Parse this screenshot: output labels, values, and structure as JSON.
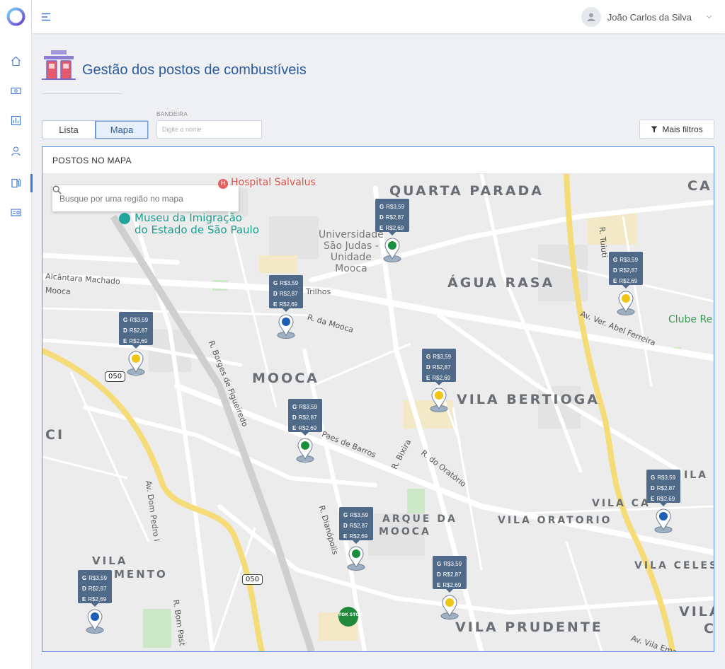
{
  "user": {
    "name": "João Carlos da Silva"
  },
  "page": {
    "title": "Gestão dos postos de combustíveis"
  },
  "view_toggle": {
    "list_label": "Lista",
    "map_label": "Mapa",
    "active": "Mapa"
  },
  "filters": {
    "brand_label": "BANDEIRA",
    "brand_placeholder": "Digite o nome",
    "more_filters_label": "Mais filtros"
  },
  "map_panel": {
    "title": "POSTOS NO MAPA",
    "search_placeholder": "Busque por uma região no mapa"
  },
  "map_labels": {
    "districts": [
      "QUARTA PARADA",
      "ÁGUA RASA",
      "MOOCA",
      "VILA BERTIOGA",
      "VILA ORATORIO",
      "VILA PRUDENTE",
      "VILA",
      "MENTO",
      "CI",
      "CA",
      "VILA CELEST",
      "VILA CA",
      "ILA I",
      "VILA",
      "C",
      "ARQUE DA",
      "MOOCA"
    ],
    "streets": [
      "Alcântara Machado",
      "Mooca",
      "Trilhos",
      "R. da Mooca",
      "Av. Ver. Abel Ferreira",
      "R. Borges de Figueiredo",
      "Paes de Barros",
      "R. Bixira",
      "R. do Oratório",
      "Av. Dom Pedro I",
      "R. Dianópolis",
      "R. Bom Past",
      "R. Tuiuti",
      "Av. Vila Ema"
    ],
    "pois": {
      "hospital": "Hospital Salvalus",
      "museum_line1": "Museu da Imigração",
      "museum_line2": "do Estado de São Paulo",
      "university_line1": "Universidade",
      "university_line2": "São Judas -",
      "university_line3": "Unidade",
      "university_line4": "Mooca",
      "club": "Clube Re",
      "store": "TOK STOK"
    },
    "shields": [
      "050",
      "050"
    ]
  },
  "stations": [
    {
      "brand": "br",
      "g": "R$3,59",
      "d": "R$2,87",
      "e": "R$2,69"
    },
    {
      "brand": "shell",
      "g": "R$3,59",
      "d": "R$2,87",
      "e": "R$2,69"
    },
    {
      "brand": "ipiranga",
      "g": "R$3,59",
      "d": "R$2,87",
      "e": "R$2,69"
    },
    {
      "brand": "shell",
      "g": "R$3,59",
      "d": "R$2,87",
      "e": "R$2,69"
    },
    {
      "brand": "shell",
      "g": "R$3,59",
      "d": "R$2,87",
      "e": "R$2,69"
    },
    {
      "brand": "br",
      "g": "R$3,59",
      "d": "R$2,87",
      "e": "R$2,69"
    },
    {
      "brand": "ipiranga",
      "g": "R$3,59",
      "d": "R$2,87",
      "e": "R$2,69"
    },
    {
      "brand": "br",
      "g": "R$3,59",
      "d": "R$2,87",
      "e": "R$2,69"
    },
    {
      "brand": "ipiranga",
      "g": "R$3,59",
      "d": "R$2,87",
      "e": "R$2,69"
    },
    {
      "brand": "shell",
      "g": "R$3,59",
      "d": "R$2,87",
      "e": "R$2,69"
    }
  ],
  "price_codes": {
    "g": "G",
    "d": "D",
    "e": "E"
  },
  "colors": {
    "accent": "#3f77d6",
    "title": "#2d5c9b",
    "marker": "#4f6a88"
  }
}
